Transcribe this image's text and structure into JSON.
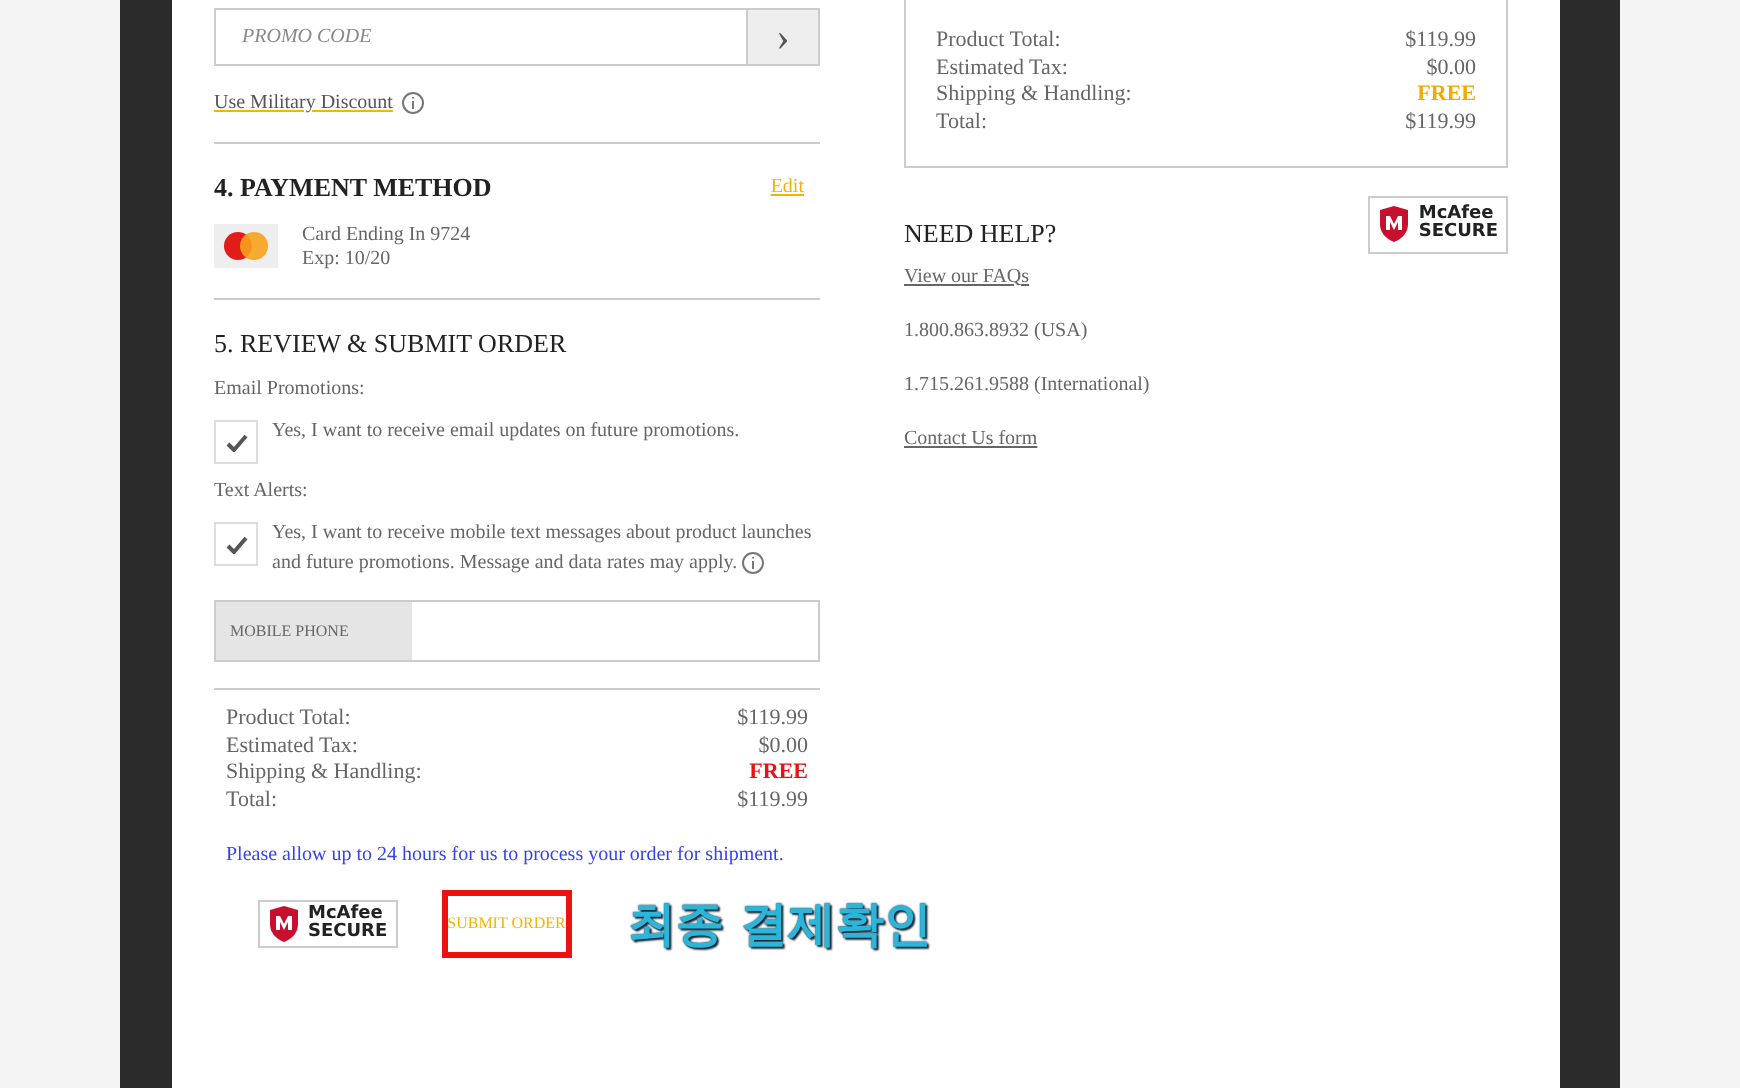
{
  "promo": {
    "placeholder": "PROMO CODE",
    "apply_icon": "›"
  },
  "military_link": "Use Military Discount",
  "payment": {
    "title": "4. PAYMENT METHOD",
    "edit": "Edit",
    "card_line": "Card Ending In 9724",
    "exp": "Exp: 10/20"
  },
  "review": {
    "title": "5. REVIEW & SUBMIT ORDER",
    "options": [
      {
        "label": "Email Promotions:",
        "text": "Yes, I want to receive email updates on future promotions.",
        "checked": true,
        "info": false
      },
      {
        "label": "Text Alerts:",
        "text": "Yes, I want to receive mobile text messages about product launches and future promotions. Message and data rates may apply.",
        "checked": true,
        "info": true
      }
    ],
    "phone": {
      "label": "MOBILE PHONE"
    },
    "summary": [
      {
        "label": "Product Total:",
        "value": "$119.99"
      },
      {
        "label": "Estimated Tax:",
        "value": "$0.00"
      },
      {
        "label": "Shipping & Handling:",
        "value": "FREE",
        "color": "#ee1111"
      },
      {
        "label": "Total:",
        "value": "$119.99"
      }
    ],
    "notice": "Please allow up to 24 hours for us to process your order for shipment.",
    "badge": {
      "brand": "McAfee",
      "secure": "SECURE"
    },
    "submit": "SUBMIT ORDER",
    "annotation": "최종 결제확인"
  },
  "side_summary": [
    {
      "label": "Product Total:",
      "value": "$119.99"
    },
    {
      "label": "Estimated Tax:",
      "value": "$0.00"
    },
    {
      "label": "Shipping & Handling:",
      "value": "FREE",
      "color": "#f5a800"
    },
    {
      "label": "Total:",
      "value": "$119.99"
    }
  ],
  "help": {
    "title": "NEED HELP?",
    "badge": {
      "brand": "McAfee",
      "secure": "SECURE"
    },
    "faq": "View our FAQs",
    "phone_usa": "1.800.863.8932 (USA)",
    "phone_intl": "1.715.261.9588 (International)",
    "contact": "Contact Us form"
  }
}
